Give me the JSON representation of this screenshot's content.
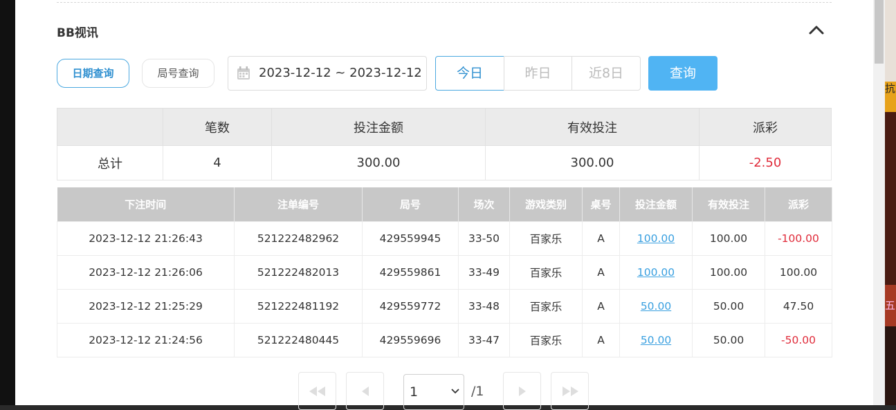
{
  "section": {
    "title": "BB视讯"
  },
  "query_tabs": {
    "date_query": "日期查询",
    "round_query": "局号查询"
  },
  "date_range": {
    "value": "2023-12-12 ~ 2023-12-12"
  },
  "quick_ranges": {
    "today": "今日",
    "yesterday": "昨日",
    "last8": "近8日"
  },
  "search_button": "查询",
  "summary": {
    "headers": [
      "",
      "笔数",
      "投注金额",
      "有效投注",
      "派彩"
    ],
    "row": {
      "label": "总计",
      "count": "4",
      "bet": "300.00",
      "valid": "300.00",
      "payout": "-2.50"
    }
  },
  "details": {
    "headers": [
      "下注时间",
      "注单编号",
      "局号",
      "场次",
      "游戏类别",
      "桌号",
      "投注金额",
      "有效投注",
      "派彩"
    ],
    "rows": [
      {
        "time": "2023-12-12 21:26:43",
        "order": "521222482962",
        "round": "429559945",
        "session": "33-50",
        "game": "百家乐",
        "table": "A",
        "bet": "100.00",
        "valid": "100.00",
        "payout": "-100.00"
      },
      {
        "time": "2023-12-12 21:26:06",
        "order": "521222482013",
        "round": "429559861",
        "session": "33-49",
        "game": "百家乐",
        "table": "A",
        "bet": "100.00",
        "valid": "100.00",
        "payout": "100.00"
      },
      {
        "time": "2023-12-12 21:25:29",
        "order": "521222481192",
        "round": "429559772",
        "session": "33-48",
        "game": "百家乐",
        "table": "A",
        "bet": "50.00",
        "valid": "50.00",
        "payout": "47.50"
      },
      {
        "time": "2023-12-12 21:24:56",
        "order": "521222480445",
        "round": "429559696",
        "session": "33-47",
        "game": "百家乐",
        "table": "A",
        "bet": "50.00",
        "valid": "50.00",
        "payout": "-50.00"
      }
    ]
  },
  "pagination": {
    "current": "1",
    "total": "/1"
  },
  "side_fragments": {
    "a": "抗",
    "b": "五"
  },
  "colors": {
    "accent": "#50b4f3",
    "negative": "#e02b3a",
    "link": "#3aa0e0"
  },
  "icons": {
    "collapse": "chevron-up-icon",
    "calendar": "calendar-icon"
  }
}
